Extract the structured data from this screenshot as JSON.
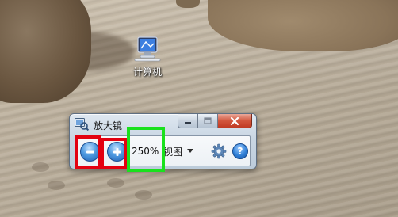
{
  "desktop": {
    "icon_label": "计算机",
    "icon_name": "computer-icon"
  },
  "magnifier": {
    "title": "放大镜",
    "app_icon": "magnifier-app-icon",
    "caption_buttons": [
      "minimize-icon",
      "maximize-icon",
      "close-icon"
    ],
    "zoom_out_icon": "minus-icon",
    "zoom_in_icon": "plus-icon",
    "zoom_level": "250%",
    "view_label": "视图",
    "settings_icon": "gear-icon",
    "help_icon": "help-icon",
    "help_glyph": "?"
  },
  "annotations": {
    "red": "#e30010",
    "green": "#19e11d"
  },
  "colors": {
    "accent_blue": "#2f7fd6",
    "close_red": "#c03a22"
  }
}
